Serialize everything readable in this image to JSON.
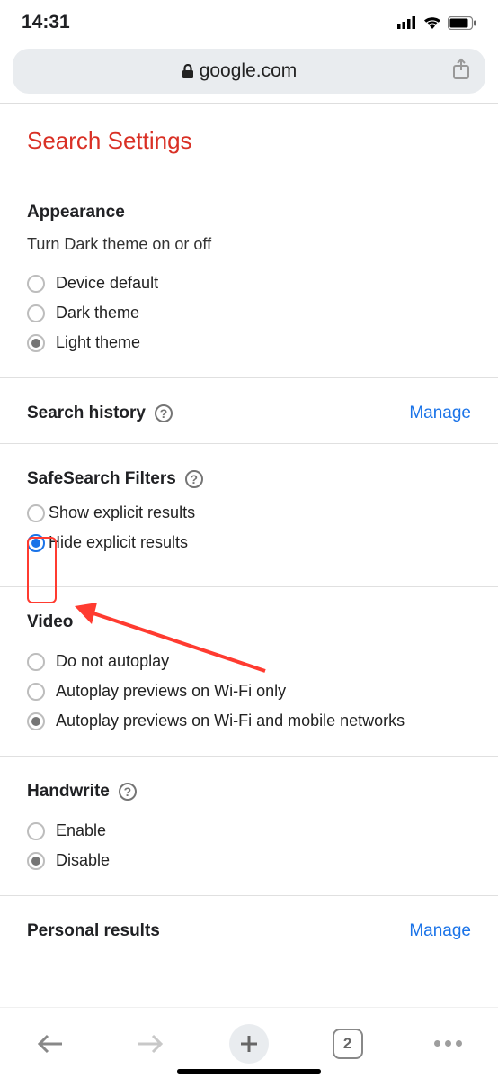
{
  "status": {
    "time": "14:31"
  },
  "address_bar": {
    "domain": "google.com"
  },
  "page": {
    "title": "Search Settings"
  },
  "appearance": {
    "heading": "Appearance",
    "subtext": "Turn Dark theme on or off",
    "options": [
      {
        "label": "Device default"
      },
      {
        "label": "Dark theme"
      },
      {
        "label": "Light theme"
      }
    ],
    "selected_index": 2
  },
  "search_history": {
    "heading": "Search history",
    "link": "Manage"
  },
  "safesearch": {
    "heading": "SafeSearch Filters",
    "options": [
      {
        "label": "Show explicit results"
      },
      {
        "label": "Hide explicit results"
      }
    ],
    "selected_index": 1
  },
  "video": {
    "heading": "Video",
    "options": [
      {
        "label": "Do not autoplay"
      },
      {
        "label": "Autoplay previews on Wi-Fi only"
      },
      {
        "label": "Autoplay previews on Wi-Fi and mobile networks"
      }
    ],
    "selected_index": 2
  },
  "handwrite": {
    "heading": "Handwrite",
    "options": [
      {
        "label": "Enable"
      },
      {
        "label": "Disable"
      }
    ],
    "selected_index": 1
  },
  "personal_results": {
    "heading": "Personal results",
    "link": "Manage"
  },
  "toolbar": {
    "tab_count": "2"
  }
}
